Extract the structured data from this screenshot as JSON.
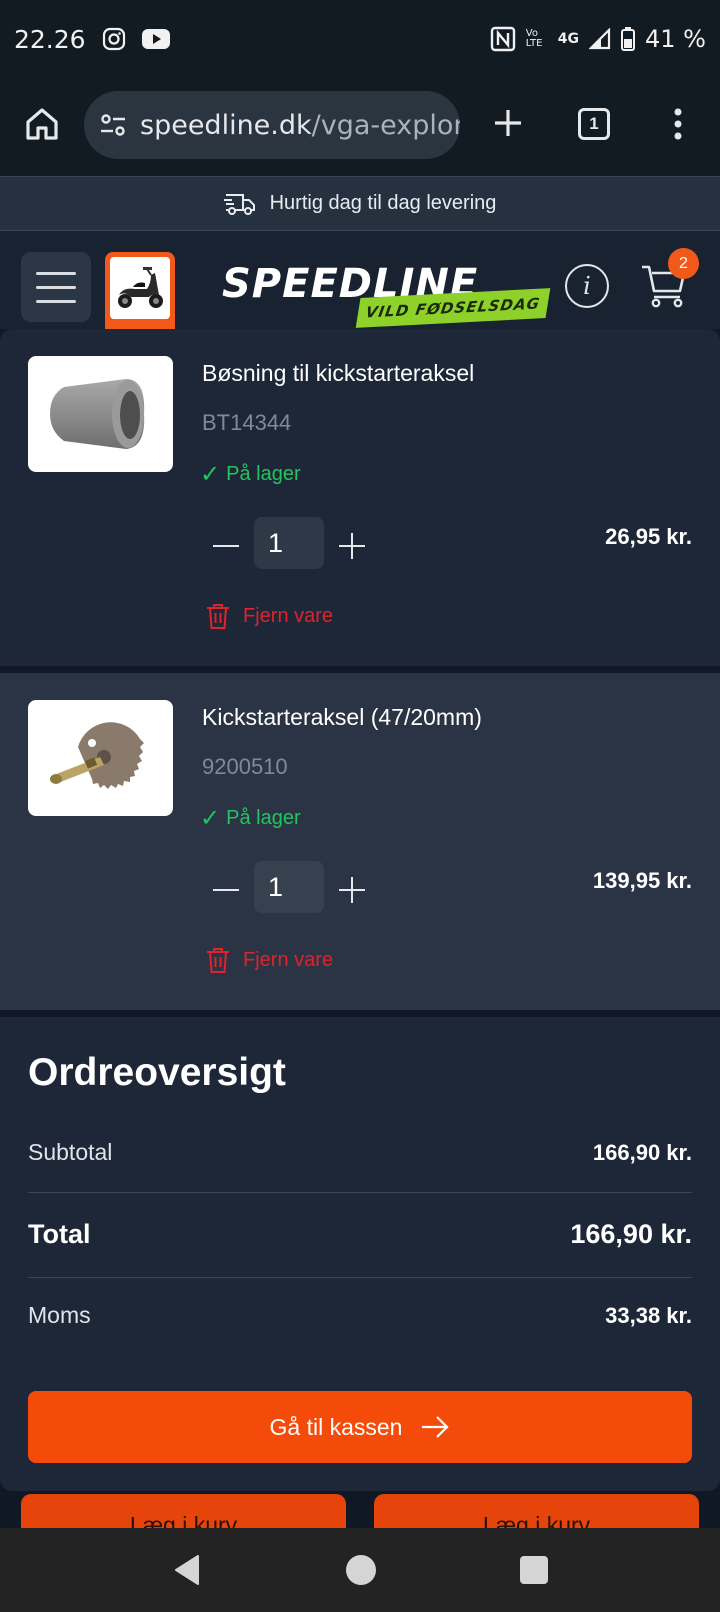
{
  "status_bar": {
    "time": "22.26",
    "network": "4G",
    "volte": "Vo LTE",
    "battery": "41 %"
  },
  "browser": {
    "url_domain": "speedline.dk",
    "url_path": "/vga-explor",
    "tab_count": "1"
  },
  "banner": {
    "delivery_text": "Hurtig dag til dag levering"
  },
  "header": {
    "logo_text": "SPEEDLINE",
    "logo_tagline": "VILD FØDSELSDAG",
    "info_glyph": "i",
    "cart_count": "2"
  },
  "cart": {
    "items": [
      {
        "name": "Bøsning til kickstarteraksel",
        "sku": "BT14344",
        "stock": "På lager",
        "quantity": "1",
        "price": "26,95 kr.",
        "remove_label": "Fjern vare"
      },
      {
        "name": "Kickstarteraksel (47/20mm)",
        "sku": "9200510",
        "stock": "På lager",
        "quantity": "1",
        "price": "139,95 kr.",
        "remove_label": "Fjern vare"
      }
    ]
  },
  "summary": {
    "title": "Ordreoversigt",
    "subtotal_label": "Subtotal",
    "subtotal_value": "166,90 kr.",
    "total_label": "Total",
    "total_value": "166,90 kr.",
    "vat_label": "Moms",
    "vat_value": "33,38 kr.",
    "checkout_label": "Gå til kassen"
  },
  "recommendations": {
    "add_to_cart_label": "Læg i kurv"
  },
  "colors": {
    "accent": "#f44b0b",
    "in_stock": "#22c55e",
    "remove": "#e0222b",
    "panel": "#1d2737"
  }
}
